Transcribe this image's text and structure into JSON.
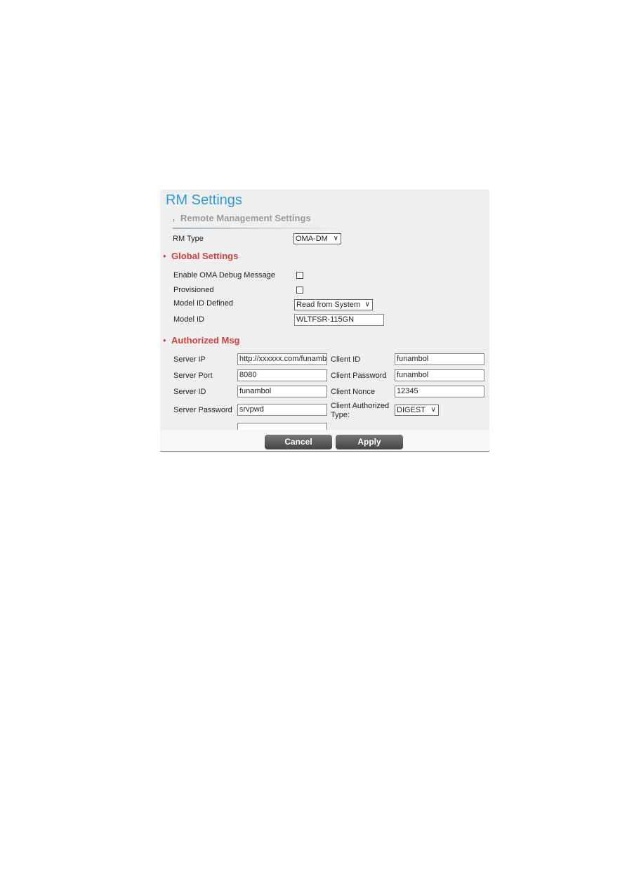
{
  "title": "RM Settings",
  "subheader": "Remote Management Settings",
  "rm_type": {
    "label": "RM Type",
    "value": "OMA-DM"
  },
  "global": {
    "heading": "Global Settings",
    "debug_label": "Enable OMA Debug Message",
    "debug_checked": false,
    "provisioned_label": "Provisioned",
    "provisioned_checked": false,
    "model_defined_label": "Model ID Defined",
    "model_defined_value": "Read from System",
    "model_id_label": "Model ID",
    "model_id_value": "WLTFSR-115GN"
  },
  "auth": {
    "heading": "Authorized Msg",
    "server_ip_label": "Server IP",
    "server_ip": "http://xxxxxx.com/funamb",
    "server_port_label": "Server Port",
    "server_port": "8080",
    "server_id_label": "Server ID",
    "server_id": "funambol",
    "server_password_label": "Server Password",
    "server_password": "srvpwd",
    "client_id_label": "Client ID",
    "client_id": "funambol",
    "client_password_label": "Client Password",
    "client_password": "funambol",
    "client_nonce_label": "Client Nonce",
    "client_nonce": "12345",
    "client_auth_type_label_1": "Client Authorized",
    "client_auth_type_label_2": "Type:",
    "client_auth_type": "DIGEST"
  },
  "buttons": {
    "cancel": "Cancel",
    "apply": "Apply"
  },
  "colors": {
    "title": "#2a9bd4",
    "section": "#d43f3a"
  }
}
